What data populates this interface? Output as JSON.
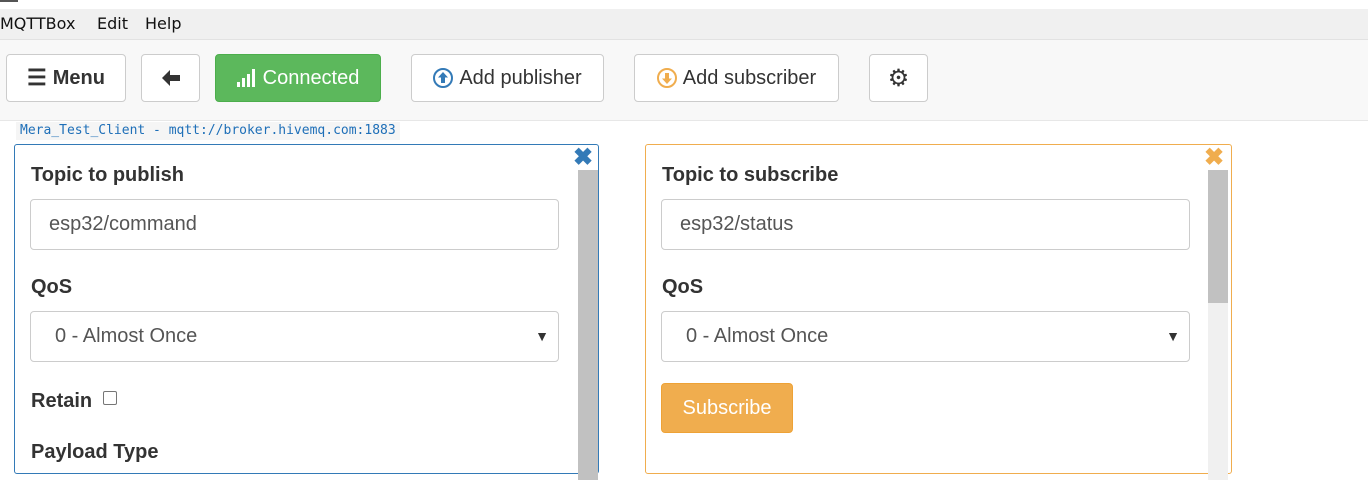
{
  "menubar": {
    "items": [
      "MQTTBox",
      "Edit",
      "Help"
    ]
  },
  "toolbar": {
    "menu_label": "Menu",
    "connected_label": "Connected",
    "add_publisher_label": "Add publisher",
    "add_subscriber_label": "Add subscriber"
  },
  "client": {
    "label": "Mera_Test_Client - mqtt://broker.hivemq.com:1883"
  },
  "publisher": {
    "topic_label": "Topic to publish",
    "topic_value": "esp32/command",
    "qos_label": "QoS",
    "qos_value": "0 - Almost Once",
    "retain_label": "Retain",
    "retain_checked": false,
    "payload_type_label": "Payload Type"
  },
  "subscriber": {
    "topic_label": "Topic to subscribe",
    "topic_value": "esp32/status",
    "qos_label": "QoS",
    "qos_value": "0 - Almost Once",
    "subscribe_label": "Subscribe"
  },
  "colors": {
    "connected": "#5cb85c",
    "publisher_border": "#337ab7",
    "subscriber_border": "#f0ad4e",
    "subscribe_button": "#f0ad4e"
  },
  "icons": {
    "menu": "hamburger-icon",
    "back": "arrow-left-icon",
    "signal": "signal-icon",
    "publish": "circle-arrow-up-icon",
    "subscribe": "circle-arrow-down-icon",
    "settings": "gear-icon",
    "close": "close-icon"
  }
}
